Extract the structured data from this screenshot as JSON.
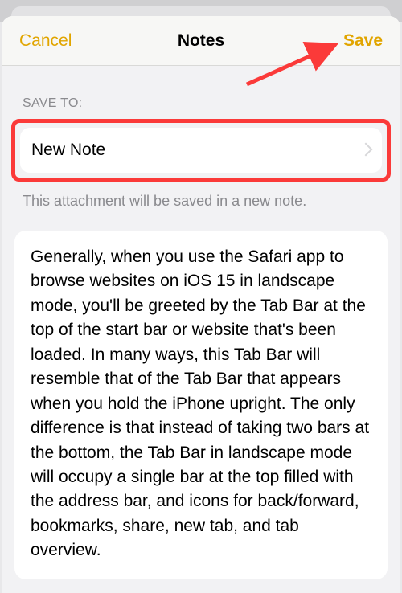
{
  "header": {
    "cancel": "Cancel",
    "title": "Notes",
    "save": "Save"
  },
  "section": {
    "label": "SAVE TO:",
    "destination": "New Note",
    "helper": "This attachment will be saved in a new note."
  },
  "note": {
    "body": "Generally, when you use the Safari app to browse websites on iOS 15 in landscape mode, you'll be greeted by the Tab Bar at the top of the start bar or website that's been loaded. In many ways, this Tab Bar will resemble that of the Tab Bar that appears when you hold the iPhone upright. The only difference is that instead of taking two bars at the bottom, the Tab Bar in landscape mode will occupy a single bar at the top filled with the address bar, and icons for back/forward, bookmarks, share, new tab, and tab overview."
  },
  "colors": {
    "accent": "#e1a500",
    "annotation": "#fb3a39"
  }
}
